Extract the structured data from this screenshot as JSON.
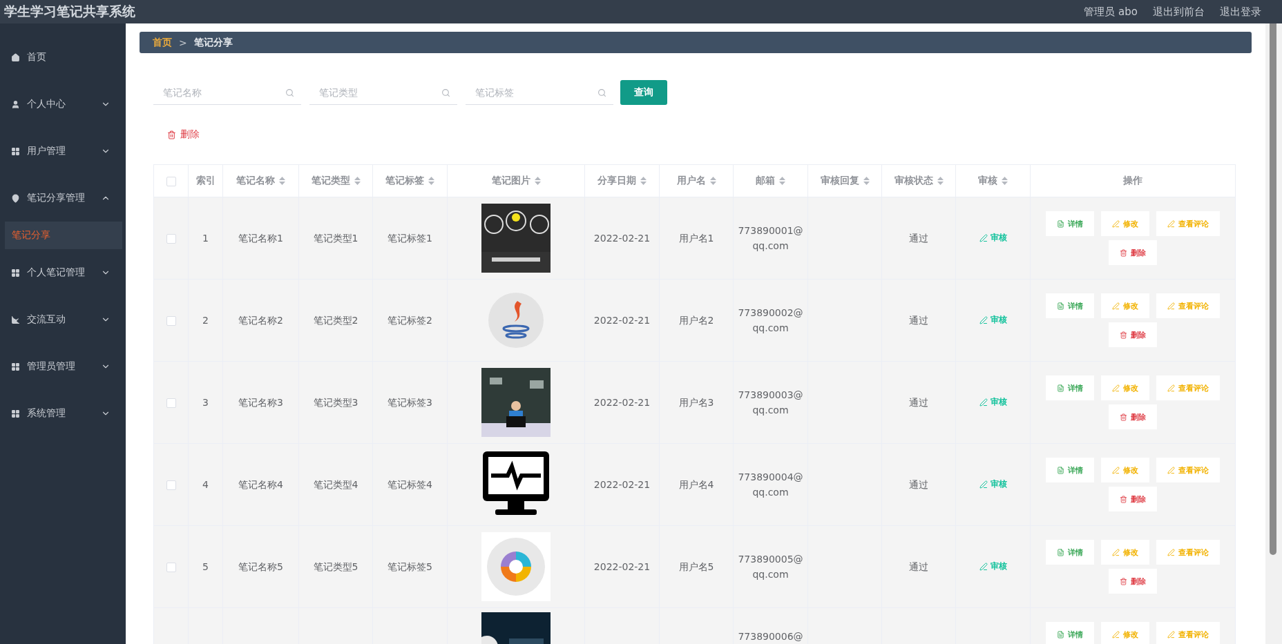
{
  "app_title": "学生学习笔记共享系统",
  "user": "管理员 abo",
  "header_links": [
    "退出到前台",
    "退出登录"
  ],
  "sidebar": {
    "items": [
      {
        "label": "首页"
      },
      {
        "label": "个人中心",
        "expanded": false
      },
      {
        "label": "用户管理",
        "expanded": false
      },
      {
        "label": "笔记分享管理",
        "expanded": true,
        "children": [
          {
            "label": "笔记分享",
            "selected": true
          }
        ]
      },
      {
        "label": "个人笔记管理",
        "expanded": false
      },
      {
        "label": "交流互动",
        "expanded": false
      },
      {
        "label": "管理员管理",
        "expanded": false
      },
      {
        "label": "系统管理",
        "expanded": false
      }
    ]
  },
  "breadcrumb": [
    "首页",
    "笔记分享"
  ],
  "breadcrumb_separator": ">",
  "search": {
    "fields": [
      {
        "placeholder": "笔记名称"
      },
      {
        "placeholder": "笔记类型"
      },
      {
        "placeholder": "笔记标签"
      }
    ],
    "button": "查询"
  },
  "delete_button": "删除",
  "table": {
    "header_checkbox": {
      "checked": false
    },
    "columns": [
      {
        "label": "索引",
        "sortable": false
      },
      {
        "label": "笔记名称",
        "sortable": true
      },
      {
        "label": "笔记类型",
        "sortable": true
      },
      {
        "label": "笔记标签",
        "sortable": true
      },
      {
        "label": "笔记图片",
        "sortable": true
      },
      {
        "label": "分享日期",
        "sortable": true
      },
      {
        "label": "用户名",
        "sortable": true
      },
      {
        "label": "邮箱",
        "sortable": true
      },
      {
        "label": "审核回复",
        "sortable": true
      },
      {
        "label": "审核状态",
        "sortable": true
      },
      {
        "label": "审核",
        "sortable": true
      },
      {
        "label": "操作",
        "sortable": false
      }
    ],
    "rows": [
      {
        "checked": false,
        "index": "1",
        "name": "笔记名称1",
        "type": "笔记类型1",
        "tag": "笔记标签1",
        "date": "2022-02-21",
        "username": "用户名1",
        "email": "773890001@qq.com",
        "status": "通过",
        "review": "审核",
        "actions": [
          {
            "kind": "detail",
            "label": "详情"
          },
          {
            "kind": "edit",
            "label": "修改"
          },
          {
            "kind": "comments",
            "label": "查看评论"
          },
          {
            "kind": "delete",
            "label": "删除"
          }
        ]
      },
      {
        "checked": false,
        "index": "2",
        "name": "笔记名称2",
        "type": "笔记类型2",
        "tag": "笔记标签2",
        "date": "2022-02-21",
        "username": "用户名2",
        "email": "773890002@qq.com",
        "status": "通过",
        "review": "审核",
        "actions": [
          {
            "kind": "detail",
            "label": "详情"
          },
          {
            "kind": "edit",
            "label": "修改"
          },
          {
            "kind": "comments",
            "label": "查看评论"
          },
          {
            "kind": "delete",
            "label": "删除"
          }
        ]
      },
      {
        "checked": false,
        "index": "3",
        "name": "笔记名称3",
        "type": "笔记类型3",
        "tag": "笔记标签3",
        "date": "2022-02-21",
        "username": "用户名3",
        "email": "773890003@qq.com",
        "status": "通过",
        "review": "审核",
        "actions": [
          {
            "kind": "detail",
            "label": "详情"
          },
          {
            "kind": "edit",
            "label": "修改"
          },
          {
            "kind": "comments",
            "label": "查看评论"
          },
          {
            "kind": "delete",
            "label": "删除"
          }
        ]
      },
      {
        "checked": false,
        "index": "4",
        "name": "笔记名称4",
        "type": "笔记类型4",
        "tag": "笔记标签4",
        "date": "2022-02-21",
        "username": "用户名4",
        "email": "773890004@qq.com",
        "status": "通过",
        "review": "审核",
        "actions": [
          {
            "kind": "detail",
            "label": "详情"
          },
          {
            "kind": "edit",
            "label": "修改"
          },
          {
            "kind": "comments",
            "label": "查看评论"
          },
          {
            "kind": "delete",
            "label": "删除"
          }
        ]
      },
      {
        "checked": false,
        "index": "5",
        "name": "笔记名称5",
        "type": "笔记类型5",
        "tag": "笔记标签5",
        "date": "2022-02-21",
        "username": "用户名5",
        "email": "773890005@qq.com",
        "status": "通过",
        "review": "审核",
        "actions": [
          {
            "kind": "detail",
            "label": "详情"
          },
          {
            "kind": "edit",
            "label": "修改"
          },
          {
            "kind": "comments",
            "label": "查看评论"
          },
          {
            "kind": "delete",
            "label": "删除"
          }
        ]
      },
      {
        "email": "773890006@",
        "actions": [
          {
            "kind": "detail",
            "label": "详情"
          },
          {
            "kind": "edit",
            "label": "修改"
          },
          {
            "kind": "comments",
            "label": "查看评论"
          }
        ]
      }
    ]
  }
}
